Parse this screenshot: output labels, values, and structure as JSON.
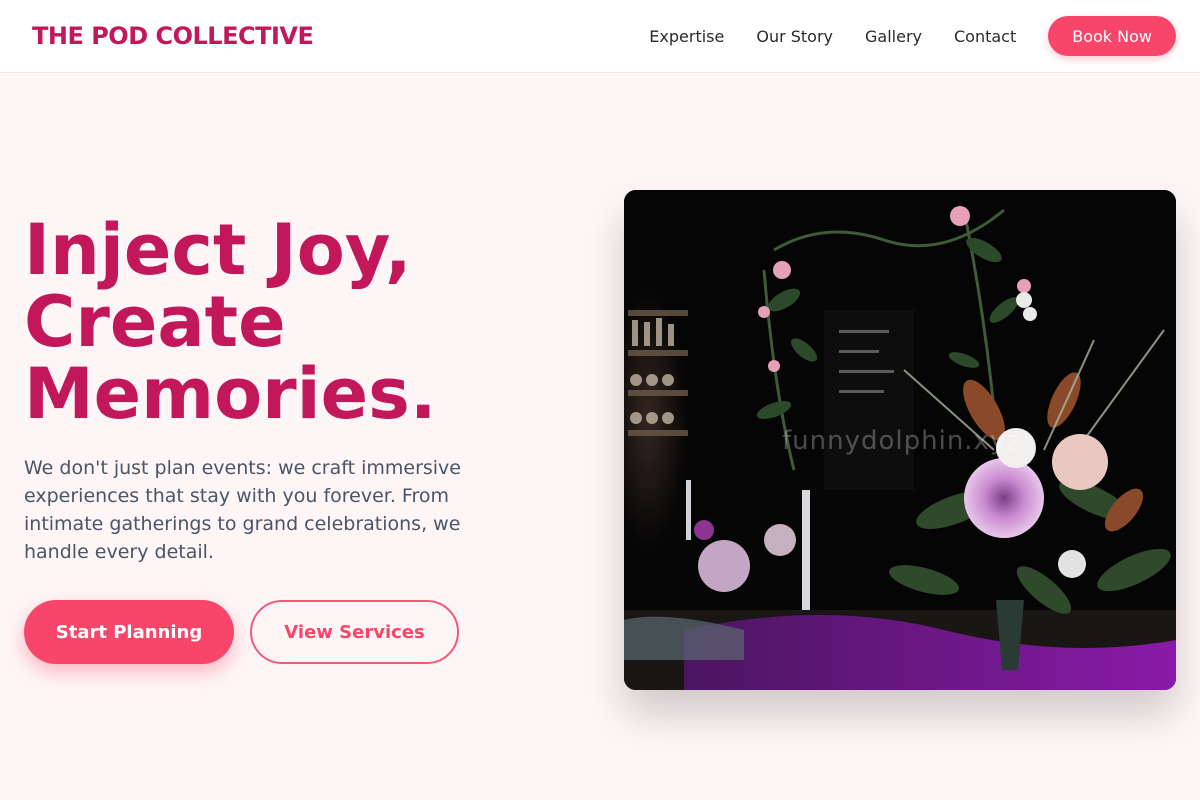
{
  "brand": {
    "name": "THE POD COLLECTIVE"
  },
  "nav": {
    "links": [
      "Expertise",
      "Our Story",
      "Gallery",
      "Contact"
    ],
    "cta_label": "Book Now"
  },
  "hero": {
    "title_lines": [
      "Inject Joy,",
      "Create",
      "Memories."
    ],
    "description": "We don't just plan events: we craft immersive experiences that stay with you forever. From intimate gatherings to grand celebrations, we handle every detail.",
    "primary_button": "Start Planning",
    "secondary_button": "View Services",
    "image_watermark": "funnydolphin.xyz"
  },
  "colors": {
    "brand": "#c2185b",
    "accent": "#f8466b",
    "background": "#fef5f6",
    "body_text": "#4a5568"
  }
}
